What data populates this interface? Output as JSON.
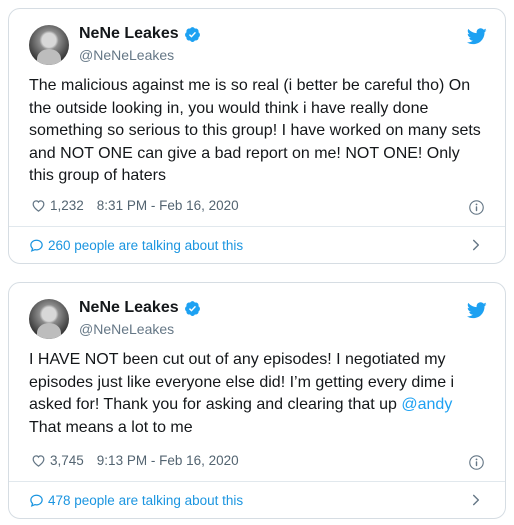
{
  "colors": {
    "accent": "#1da1f2",
    "verified": "#1da1f2",
    "text": "#14171a",
    "muted": "#657786",
    "border": "#d6dde3"
  },
  "tweets": [
    {
      "author": {
        "name": "NeNe Leakes",
        "handle": "@NeNeLeakes",
        "verified": true
      },
      "text_lines": [
        "The malicious against me is so real (i better be careful tho) On",
        "the outside looking in, you would think i have really done",
        "something so serious to this group! I have worked on many sets",
        "and NOT ONE can give a bad report on me! NOT ONE! Only",
        "this group of haters"
      ],
      "likes": "1,232",
      "timestamp": "8:31 PM - Feb 16, 2020",
      "talking": "260 people are talking about this"
    },
    {
      "author": {
        "name": "NeNe Leakes",
        "handle": "@NeNeLeakes",
        "verified": true
      },
      "text_lines": [
        "I HAVE NOT been cut out of any episodes! I negotiated my",
        "episodes just like everyone else did! I’m getting every dime i",
        "asked for! Thank you for asking and clearing that up",
        "That means a lot to me"
      ],
      "mention": "@andy",
      "likes": "3,745",
      "timestamp": "9:13 PM - Feb 16, 2020",
      "talking": "478 people are talking about this"
    }
  ],
  "icons": [
    "verified-badge-icon",
    "twitter-bird-icon",
    "heart-icon",
    "info-icon",
    "speech-bubble-icon",
    "chevron-right-icon"
  ]
}
